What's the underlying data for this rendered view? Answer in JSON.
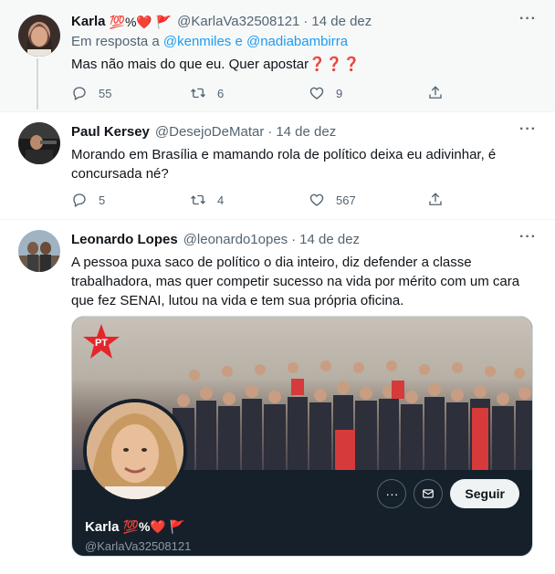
{
  "tweets": [
    {
      "name": "Karla",
      "name_emoji": "💯%❤️ 🚩",
      "handle": "@KarlaVa32508121",
      "date": "14 de dez",
      "reply_prefix": "Em resposta a",
      "reply_users": "@kenmiles e @nadiabambirra",
      "text": "Mas não mais do que eu. Quer apostar",
      "text_suffix": "❓❓❓",
      "replies": "55",
      "retweets": "6",
      "likes": "9"
    },
    {
      "name": "Paul Kersey",
      "handle": "@DesejoDeMatar",
      "date": "14 de dez",
      "text": "Morando em Brasília e mamando rola de político deixa eu adivinhar, é concursada né?",
      "replies": "5",
      "retweets": "4",
      "likes": "567"
    },
    {
      "name": "Leonardo Lopes",
      "handle": "@leonardo1opes",
      "date": "14 de dez",
      "text": "A pessoa puxa saco de político o dia inteiro, diz defender a classe trabalhadora, mas quer competir sucesso na vida por mérito com um cara que fez SENAI, lutou na vida e tem sua própria oficina."
    }
  ],
  "card": {
    "logo_text": "PT",
    "follow_label": "Seguir",
    "name": "Karla",
    "name_emoji": "💯%❤️ 🚩",
    "handle": "@KarlaVa32508121"
  },
  "colors": {
    "accent": "#1d9bf0",
    "text": "#0f1419",
    "muted": "#536471",
    "highlight_bg": "#f7f9f9",
    "card_bg": "#15202b",
    "pt_red": "#e3262a"
  },
  "icons": [
    "reply-icon",
    "retweet-icon",
    "like-icon",
    "share-icon",
    "more-icon",
    "message-icon",
    "card-more-icon"
  ]
}
